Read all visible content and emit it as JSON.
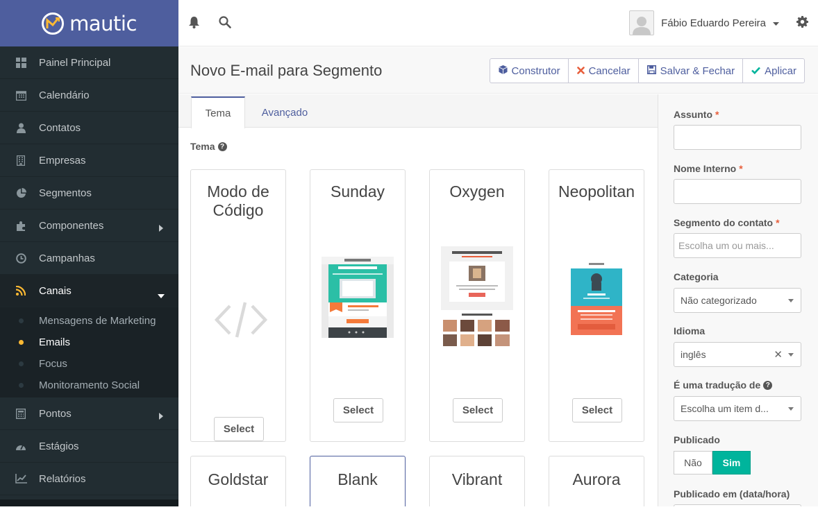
{
  "brand": {
    "name": "mautic",
    "logo_color": "#fdb933"
  },
  "sidebar": {
    "items": [
      {
        "label": "Painel Principal",
        "icon": "dashboard-icon"
      },
      {
        "label": "Calendário",
        "icon": "calendar-icon"
      },
      {
        "label": "Contatos",
        "icon": "user-icon"
      },
      {
        "label": "Empresas",
        "icon": "building-icon"
      },
      {
        "label": "Segmentos",
        "icon": "pie-chart-icon"
      },
      {
        "label": "Componentes",
        "icon": "puzzle-icon"
      },
      {
        "label": "Campanhas",
        "icon": "clock-icon"
      },
      {
        "label": "Canais",
        "icon": "rss-icon"
      }
    ],
    "channels_sub": [
      {
        "label": "Mensagens de Marketing"
      },
      {
        "label": "Emails"
      },
      {
        "label": "Focus"
      },
      {
        "label": "Monitoramento Social"
      }
    ],
    "items_after": [
      {
        "label": "Pontos",
        "icon": "calculator-icon"
      },
      {
        "label": "Estágios",
        "icon": "tachometer-icon"
      },
      {
        "label": "Relatórios",
        "icon": "line-chart-icon"
      }
    ]
  },
  "topbar": {
    "user_name": "Fábio Eduardo Pereira"
  },
  "page": {
    "title": "Novo E-mail para Segmento",
    "buttons": {
      "builder": "Construtor",
      "cancel": "Cancelar",
      "save_close": "Salvar & Fechar",
      "apply": "Aplicar"
    }
  },
  "tabs": {
    "theme": "Tema",
    "advanced": "Avançado"
  },
  "theme_section": {
    "label": "Tema"
  },
  "themes": [
    {
      "name": "Modo de Código",
      "select": "Select"
    },
    {
      "name": "Sunday",
      "select": "Select"
    },
    {
      "name": "Oxygen",
      "select": "Select"
    },
    {
      "name": "Neopolitan",
      "select": "Select"
    },
    {
      "name": "Goldstar"
    },
    {
      "name": "Blank"
    },
    {
      "name": "Vibrant"
    },
    {
      "name": "Aurora"
    }
  ],
  "form": {
    "subject_label": "Assunto",
    "internal_name_label": "Nome Interno",
    "segment_label": "Segmento do contato",
    "segment_placeholder": "Escolha um ou mais...",
    "category_label": "Categoria",
    "category_value": "Não categorizado",
    "language_label": "Idioma",
    "language_value": "inglês",
    "translation_label": "É uma tradução de",
    "translation_value": "Escolha um item d...",
    "published_label": "Publicado",
    "published_no": "Não",
    "published_yes": "Sim",
    "published_at_label": "Publicado em (data/hora)",
    "required_mark": "*"
  },
  "colors": {
    "brand_purple": "#4e5e9e",
    "sidebar_bg": "#222d32",
    "accent_teal": "#00b49c",
    "required_red": "#e85e3b",
    "active_dot": "#fdb933"
  }
}
